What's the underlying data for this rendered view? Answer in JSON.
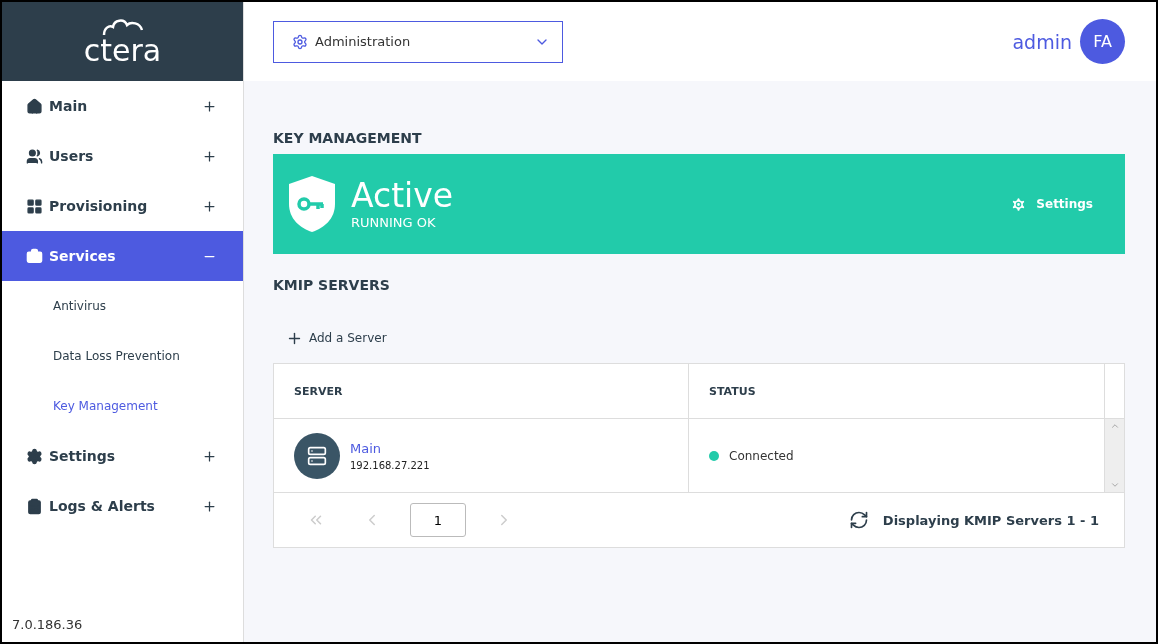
{
  "sidebar": {
    "logo": "ctera",
    "items": [
      {
        "label": "Main",
        "expanded": false,
        "selected": false
      },
      {
        "label": "Users",
        "expanded": false,
        "selected": false
      },
      {
        "label": "Provisioning",
        "expanded": false,
        "selected": false
      },
      {
        "label": "Services",
        "expanded": true,
        "selected": true,
        "children": [
          {
            "label": "Antivirus",
            "selected": false
          },
          {
            "label": "Data Loss Prevention",
            "selected": false
          },
          {
            "label": "Key Management",
            "selected": true
          }
        ]
      },
      {
        "label": "Settings",
        "expanded": false,
        "selected": false
      },
      {
        "label": "Logs & Alerts",
        "expanded": false,
        "selected": false
      }
    ],
    "version": "7.0.186.36"
  },
  "header": {
    "dropdown": "Administration",
    "user": "admin",
    "avatar": "FA"
  },
  "key_management": {
    "title": "KEY MANAGEMENT",
    "status": "Active",
    "substatus": "RUNNING OK",
    "settings": "Settings"
  },
  "kmip": {
    "title": "KMIP SERVERS",
    "add": "Add a Server",
    "columns": [
      "SERVER",
      "STATUS"
    ],
    "rows": [
      {
        "name": "Main",
        "address": "192.168.27.221",
        "status": "Connected",
        "color": "#22cbaa"
      }
    ],
    "pager": {
      "first_disabled": true,
      "prev_disabled": true,
      "next_disabled": true,
      "page": "1",
      "summary": "Displaying KMIP Servers 1 - 1"
    }
  }
}
